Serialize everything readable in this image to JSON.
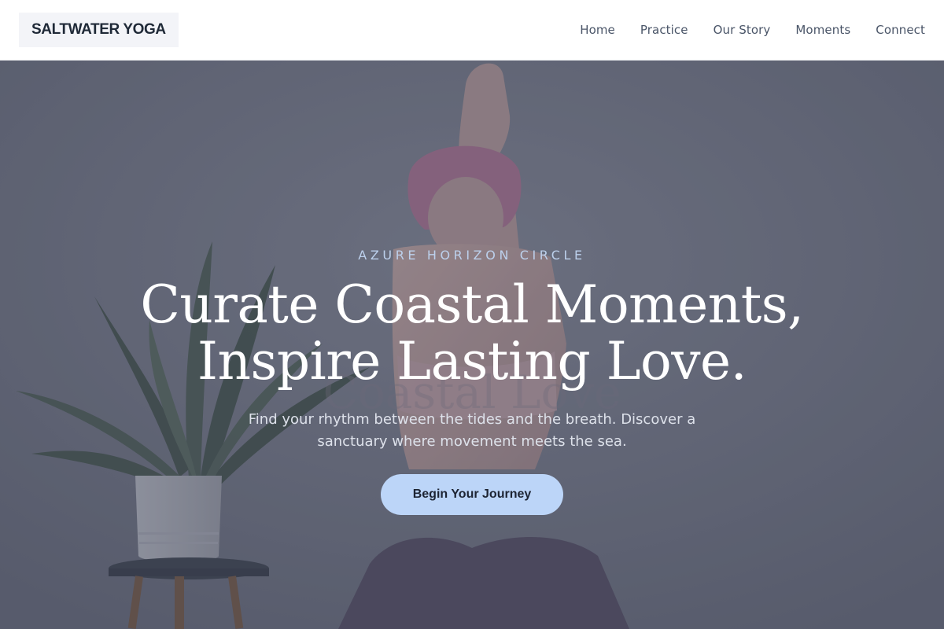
{
  "brand": {
    "name": "SALTWATER YOGA"
  },
  "nav": {
    "items": [
      {
        "label": "Home"
      },
      {
        "label": "Practice"
      },
      {
        "label": "Our Story"
      },
      {
        "label": "Moments"
      },
      {
        "label": "Connect"
      }
    ]
  },
  "hero": {
    "eyebrow": "AZURE HORIZON CIRCLE",
    "headline_line1": "Curate Coastal Moments,",
    "headline_line2": "Inspire Lasting Love.",
    "subtitle": "Find your rhythm between the tides and the breath. Discover a sanctuary where movement meets the sea.",
    "cta_label": "Begin Your Journey"
  },
  "colors": {
    "nav_background": "#ffffff",
    "brand_background": "#f3f4f8",
    "hero_overlay": "#64687a",
    "eyebrow": "#bcd0ec",
    "cta_background": "#bcd5f8",
    "cta_text": "#1d2433"
  }
}
